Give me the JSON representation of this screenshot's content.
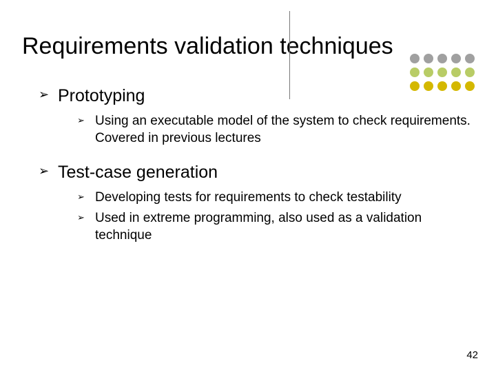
{
  "title": "Requirements validation techniques",
  "bullets": [
    {
      "label": "Prototyping",
      "children": [
        "Using an executable model of the system to check requirements. Covered in previous lectures"
      ]
    },
    {
      "label": "Test-case generation",
      "children": [
        "Developing tests for requirements to check testability",
        "Used in extreme programming, also used as a validation technique"
      ]
    }
  ],
  "page_number": "42",
  "dot_colors": {
    "row1": "#a0a0a0",
    "row2": "#b8cc66",
    "row3": "#d4b800"
  }
}
